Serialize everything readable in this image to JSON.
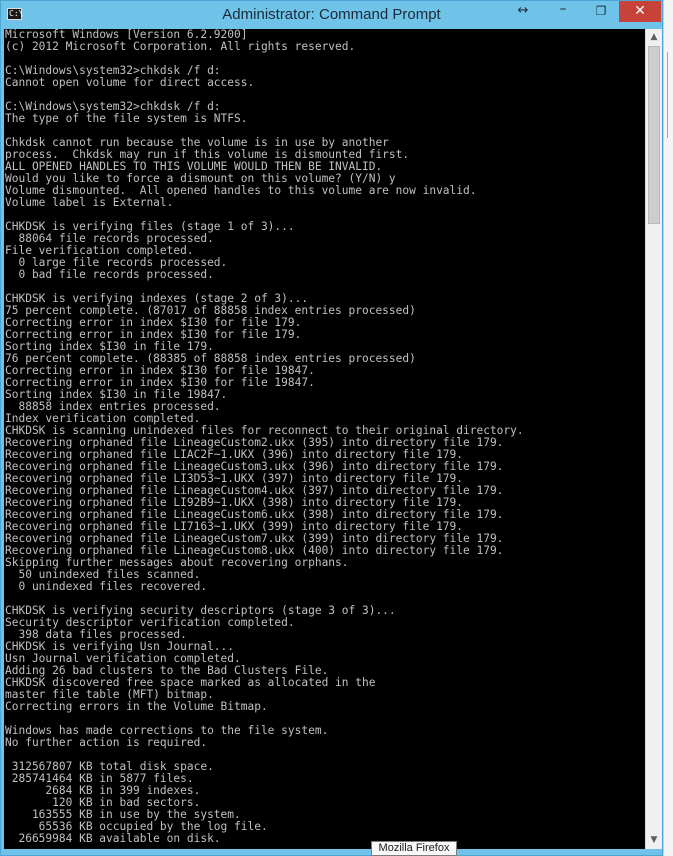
{
  "window": {
    "title": "Administrator: Command Prompt",
    "title_icon_text": "C:\\",
    "resize_glyph": "↔",
    "minimize_glyph": "–",
    "maximize_glyph": "❐",
    "close_glyph": "✕"
  },
  "colors": {
    "titlebar": "#6fc3e8",
    "console_background": "#000000",
    "console_text": "#c0c0c0",
    "close_button": "#c7433a"
  },
  "console": {
    "lines": [
      "Microsoft Windows [Version 6.2.9200]",
      "(c) 2012 Microsoft Corporation. All rights reserved.",
      "",
      "C:\\Windows\\system32>chkdsk /f d:",
      "Cannot open volume for direct access.",
      "",
      "C:\\Windows\\system32>chkdsk /f d:",
      "The type of the file system is NTFS.",
      "",
      "Chkdsk cannot run because the volume is in use by another",
      "process.  Chkdsk may run if this volume is dismounted first.",
      "ALL OPENED HANDLES TO THIS VOLUME WOULD THEN BE INVALID.",
      "Would you like to force a dismount on this volume? (Y/N) y",
      "Volume dismounted.  All opened handles to this volume are now invalid.",
      "Volume label is External.",
      "",
      "CHKDSK is verifying files (stage 1 of 3)...",
      "  88064 file records processed.",
      "File verification completed.",
      "  0 large file records processed.",
      "  0 bad file records processed.",
      "",
      "CHKDSK is verifying indexes (stage 2 of 3)...",
      "75 percent complete. (87017 of 88858 index entries processed)",
      "Correcting error in index $I30 for file 179.",
      "Correcting error in index $I30 for file 179.",
      "Sorting index $I30 in file 179.",
      "76 percent complete. (88385 of 88858 index entries processed)",
      "Correcting error in index $I30 for file 19847.",
      "Correcting error in index $I30 for file 19847.",
      "Sorting index $I30 in file 19847.",
      "  88858 index entries processed.",
      "Index verification completed.",
      "CHKDSK is scanning unindexed files for reconnect to their original directory.",
      "Recovering orphaned file LineageCustom2.ukx (395) into directory file 179.",
      "Recovering orphaned file LIAC2F~1.UKX (396) into directory file 179.",
      "Recovering orphaned file LineageCustom3.ukx (396) into directory file 179.",
      "Recovering orphaned file LI3D53~1.UKX (397) into directory file 179.",
      "Recovering orphaned file LineageCustom4.ukx (397) into directory file 179.",
      "Recovering orphaned file LI92B9~1.UKX (398) into directory file 179.",
      "Recovering orphaned file LineageCustom6.ukx (398) into directory file 179.",
      "Recovering orphaned file LI7163~1.UKX (399) into directory file 179.",
      "Recovering orphaned file LineageCustom7.ukx (399) into directory file 179.",
      "Recovering orphaned file LineageCustom8.ukx (400) into directory file 179.",
      "Skipping further messages about recovering orphans.",
      "  50 unindexed files scanned.",
      "  0 unindexed files recovered.",
      "",
      "CHKDSK is verifying security descriptors (stage 3 of 3)...",
      "Security descriptor verification completed.",
      "  398 data files processed.",
      "CHKDSK is verifying Usn Journal...",
      "Usn Journal verification completed.",
      "Adding 26 bad clusters to the Bad Clusters File.",
      "CHKDSK discovered free space marked as allocated in the",
      "master file table (MFT) bitmap.",
      "Correcting errors in the Volume Bitmap.",
      "",
      "Windows has made corrections to the file system.",
      "No further action is required.",
      "",
      " 312567807 KB total disk space.",
      " 285741464 KB in 5877 files.",
      "      2684 KB in 399 indexes.",
      "       120 KB in bad sectors.",
      "    163555 KB in use by the system.",
      "     65536 KB occupied by the log file.",
      "  26659984 KB available on disk."
    ]
  },
  "scrollbar": {
    "up_glyph": "▲",
    "down_glyph": "▼"
  },
  "tooltip": {
    "text": "Mozilla Firefox"
  }
}
